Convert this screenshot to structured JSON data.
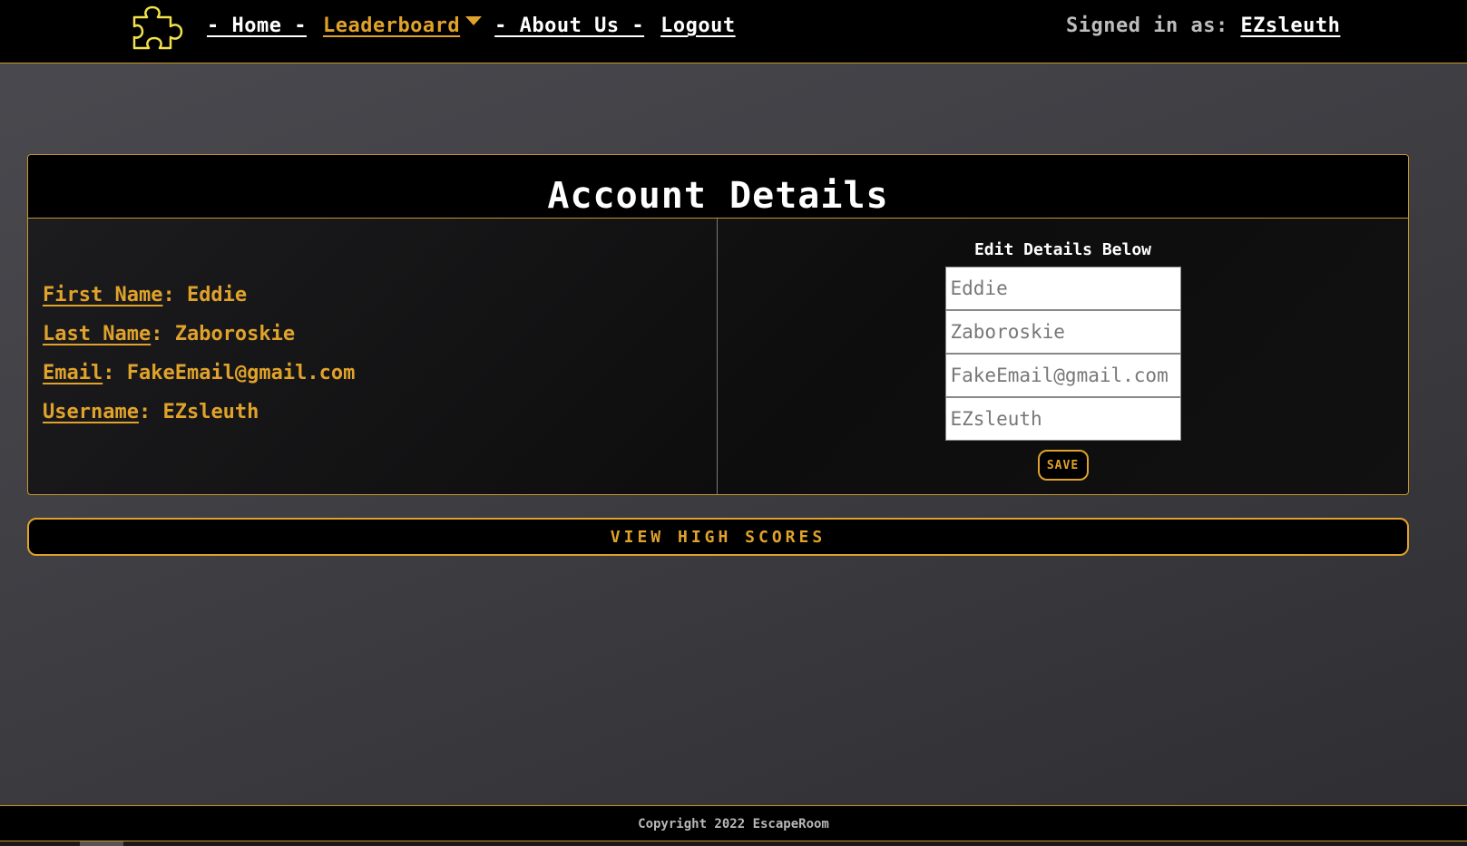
{
  "navbar": {
    "logo_icon": "puzzle-piece-icon",
    "links": {
      "home": "- Home -",
      "leaderboard": "Leaderboard",
      "about": "- About Us -",
      "logout": "Logout"
    },
    "signed_in_label": "Signed in as: ",
    "signed_in_user": "EZsleuth"
  },
  "account": {
    "title": "Account Details",
    "details": {
      "first_name_label": "First Name",
      "first_name_value": ": Eddie",
      "last_name_label": "Last Name",
      "last_name_value": ": Zaboroskie",
      "email_label": "Email",
      "email_value": ": FakeEmail@gmail.com",
      "username_label": "Username",
      "username_value": ": EZsleuth"
    },
    "edit": {
      "title": "Edit Details Below",
      "first_name_placeholder": "Eddie",
      "last_name_placeholder": "Zaboroskie",
      "email_placeholder": "FakeEmail@gmail.com",
      "username_placeholder": "EZsleuth",
      "save_label": "SAVE"
    }
  },
  "high_scores_button": "VIEW HIGH SCORES",
  "footer": {
    "text": "Copyright 2022 EscapeRoom"
  },
  "colors": {
    "accent": "#e0a22b",
    "border": "#c8962a",
    "bar_background": "#000000"
  }
}
